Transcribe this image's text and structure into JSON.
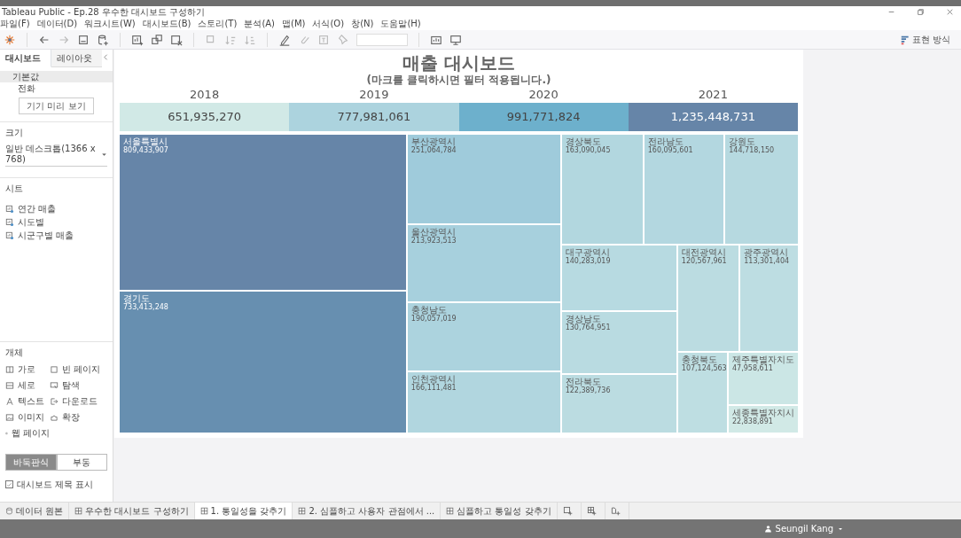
{
  "window": {
    "title": "Tableau Public - Ep.28 우수한 대시보드 구성하기"
  },
  "menu": [
    "파일(F)",
    "데이터(D)",
    "워크시트(W)",
    "대시보드(B)",
    "스토리(T)",
    "분석(A)",
    "맵(M)",
    "서식(O)",
    "창(N)",
    "도움말(H)"
  ],
  "toolbar": {
    "show_me": "표현 방식"
  },
  "side_panel": {
    "tabs": [
      {
        "label": "대시보드",
        "selected": true
      },
      {
        "label": "레이아웃",
        "selected": false
      }
    ],
    "devices": [
      {
        "label": "기본값",
        "selected": true
      },
      {
        "label": "전화",
        "selected": false
      }
    ],
    "device_preview_button": "기기 미리 보기",
    "size": {
      "heading": "크기",
      "value": "일반 데스크톱(1366 x 768)"
    },
    "sheets": {
      "heading": "시트",
      "items": [
        "연간 매출",
        "시도별",
        "시군구별 매출"
      ]
    },
    "objects": {
      "heading": "개체",
      "items": [
        {
          "label": "가로",
          "kind": "horizontal"
        },
        {
          "label": "빈 페이지",
          "kind": "blank"
        },
        {
          "label": "세로",
          "kind": "vertical"
        },
        {
          "label": "탐색",
          "kind": "navigation"
        },
        {
          "label": "텍스트",
          "kind": "text"
        },
        {
          "label": "다운로드",
          "kind": "download"
        },
        {
          "label": "이미지",
          "kind": "image"
        },
        {
          "label": "확장",
          "kind": "extension"
        },
        {
          "label": "웹 페이지",
          "kind": "web"
        }
      ]
    },
    "layout_mode": [
      {
        "label": "바둑판식",
        "selected": true
      },
      {
        "label": "부동",
        "selected": false
      }
    ],
    "show_title": {
      "label": "대시보드 제목 표시",
      "checked": true
    }
  },
  "dashboard": {
    "title": "매출 대시보드",
    "subtitle": "(마크를 클릭하시면 필터 적용됩니다.)",
    "years": [
      {
        "year": "2018",
        "sales": "651,935,270"
      },
      {
        "year": "2019",
        "sales": "777,981,061"
      },
      {
        "year": "2020",
        "sales": "991,771,824"
      },
      {
        "year": "2021",
        "sales": "1,235,448,731"
      }
    ],
    "treemap": [
      {
        "region": "서울특별시",
        "sales": "809,433,907"
      },
      {
        "region": "경기도",
        "sales": "733,413,248"
      },
      {
        "region": "부산광역시",
        "sales": "251,064,784"
      },
      {
        "region": "울산광역시",
        "sales": "213,923,513"
      },
      {
        "region": "충청남도",
        "sales": "190,057,019"
      },
      {
        "region": "인천광역시",
        "sales": "166,111,481"
      },
      {
        "region": "경상북도",
        "sales": "163,090,045"
      },
      {
        "region": "전라남도",
        "sales": "160,095,601"
      },
      {
        "region": "강원도",
        "sales": "144,718,150"
      },
      {
        "region": "대구광역시",
        "sales": "140,283,019"
      },
      {
        "region": "경상남도",
        "sales": "130,764,951"
      },
      {
        "region": "전라북도",
        "sales": "122,389,736"
      },
      {
        "region": "대전광역시",
        "sales": "120,567,961"
      },
      {
        "region": "광주광역시",
        "sales": "113,301,404"
      },
      {
        "region": "충청북도",
        "sales": "107,124,563"
      },
      {
        "region": "제주특별자치도",
        "sales": "47,958,611"
      },
      {
        "region": "세종특별자치시",
        "sales": "22,838,891"
      }
    ]
  },
  "sheet_tabs": [
    {
      "label": "데이터 원본",
      "kind": "datasource",
      "selected": false
    },
    {
      "label": "우수한 대시보드 구성하기",
      "kind": "dashboard",
      "selected": false
    },
    {
      "label": "1. 통일성을 갖추기",
      "kind": "dashboard",
      "selected": true
    },
    {
      "label": "2. 심플하고 사용자 관점에서 ...",
      "kind": "dashboard",
      "selected": false
    },
    {
      "label": "심플하고 통일성 갖추기",
      "kind": "dashboard",
      "selected": false
    }
  ],
  "status_bar": {
    "user": "Seungil Kang"
  }
}
